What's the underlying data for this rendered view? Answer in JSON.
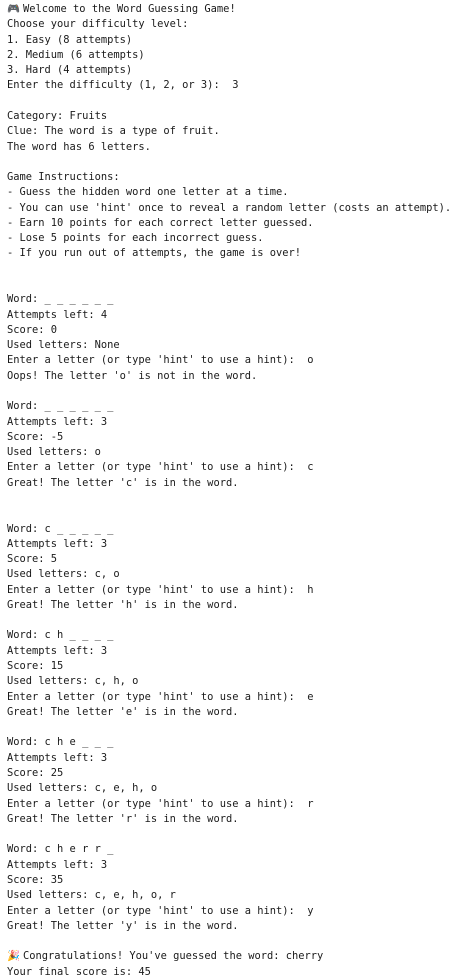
{
  "lines": [
    {
      "icon": "game-controller",
      "text": "Welcome to the Word Guessing Game!"
    },
    "Choose your difficulty level:",
    "1. Easy (8 attempts)",
    "2. Medium (6 attempts)",
    "3. Hard (4 attempts)",
    "Enter the difficulty (1, 2, or 3):  3",
    "",
    "Category: Fruits",
    "Clue: The word is a type of fruit.",
    "The word has 6 letters.",
    "",
    "Game Instructions:",
    "- Guess the hidden word one letter at a time.",
    "- You can use 'hint' once to reveal a random letter (costs an attempt).",
    "- Earn 10 points for each correct letter guessed.",
    "- Lose 5 points for each incorrect guess.",
    "- If you run out of attempts, the game is over!",
    "",
    "",
    "Word: _ _ _ _ _ _",
    "Attempts left: 4",
    "Score: 0",
    "Used letters: None",
    "Enter a letter (or type 'hint' to use a hint):  o",
    "Oops! The letter 'o' is not in the word.",
    "",
    "Word: _ _ _ _ _ _",
    "Attempts left: 3",
    "Score: -5",
    "Used letters: o",
    "Enter a letter (or type 'hint' to use a hint):  c",
    "Great! The letter 'c' is in the word.",
    "",
    "",
    "Word: c _ _ _ _ _",
    "Attempts left: 3",
    "Score: 5",
    "Used letters: c, o",
    "Enter a letter (or type 'hint' to use a hint):  h",
    "Great! The letter 'h' is in the word.",
    "",
    "Word: c h _ _ _ _",
    "Attempts left: 3",
    "Score: 15",
    "Used letters: c, h, o",
    "Enter a letter (or type 'hint' to use a hint):  e",
    "Great! The letter 'e' is in the word.",
    "",
    "Word: c h e _ _ _",
    "Attempts left: 3",
    "Score: 25",
    "Used letters: c, e, h, o",
    "Enter a letter (or type 'hint' to use a hint):  r",
    "Great! The letter 'r' is in the word.",
    "",
    "Word: c h e r r _",
    "Attempts left: 3",
    "Score: 35",
    "Used letters: c, e, h, o, r",
    "Enter a letter (or type 'hint' to use a hint):  y",
    "Great! The letter 'y' is in the word.",
    "",
    {
      "icon": "party-popper",
      "text": "Congratulations! You've guessed the word: cherry"
    },
    "Your final score is: 45"
  ],
  "icons": {
    "game-controller": "🎮",
    "party-popper": "🎉"
  }
}
